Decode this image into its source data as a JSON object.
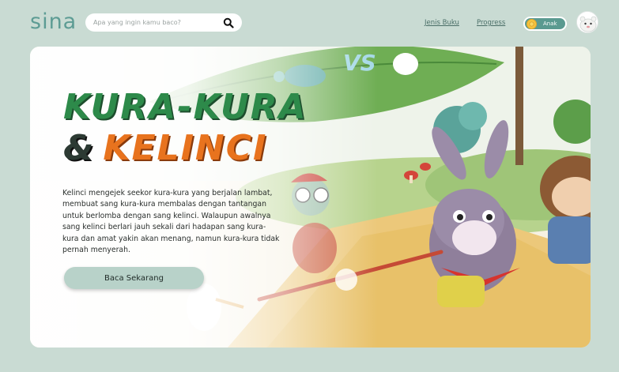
{
  "header": {
    "logo": "sina",
    "search": {
      "placeholder": "Apa yang ingin kamu baco?"
    },
    "nav": {
      "jenis_buku": "Jenis Buku",
      "progress": "Progress"
    },
    "mode_toggle": {
      "label": "Anak"
    }
  },
  "hero": {
    "title_line1": "KURA-KURA",
    "title_amp": "&",
    "title_line2": "KELINCI",
    "description": "Kelinci mengejek seekor kura-kura yang berjalan lambat, membuat sang kura-kura membalas dengan tantangan untuk berlomba dengan sang kelinci. Walaupun awalnya sang kelinci berlari jauh sekali dari hadapan sang kura-kura dan amat yakin akan menang, namun kura-kura tidak pernah menyerah.",
    "vs_text": "VS",
    "cta_label": "Baca Sekarang"
  },
  "colors": {
    "background": "#c9dbd3",
    "logo": "#5d9c94",
    "toggle": "#5a9a90",
    "title_green": "#2d8a4a",
    "title_orange": "#e8731e",
    "cta": "#b8d2c9"
  },
  "icons": [
    "search-icon",
    "sun-icon",
    "avatar-icon"
  ]
}
